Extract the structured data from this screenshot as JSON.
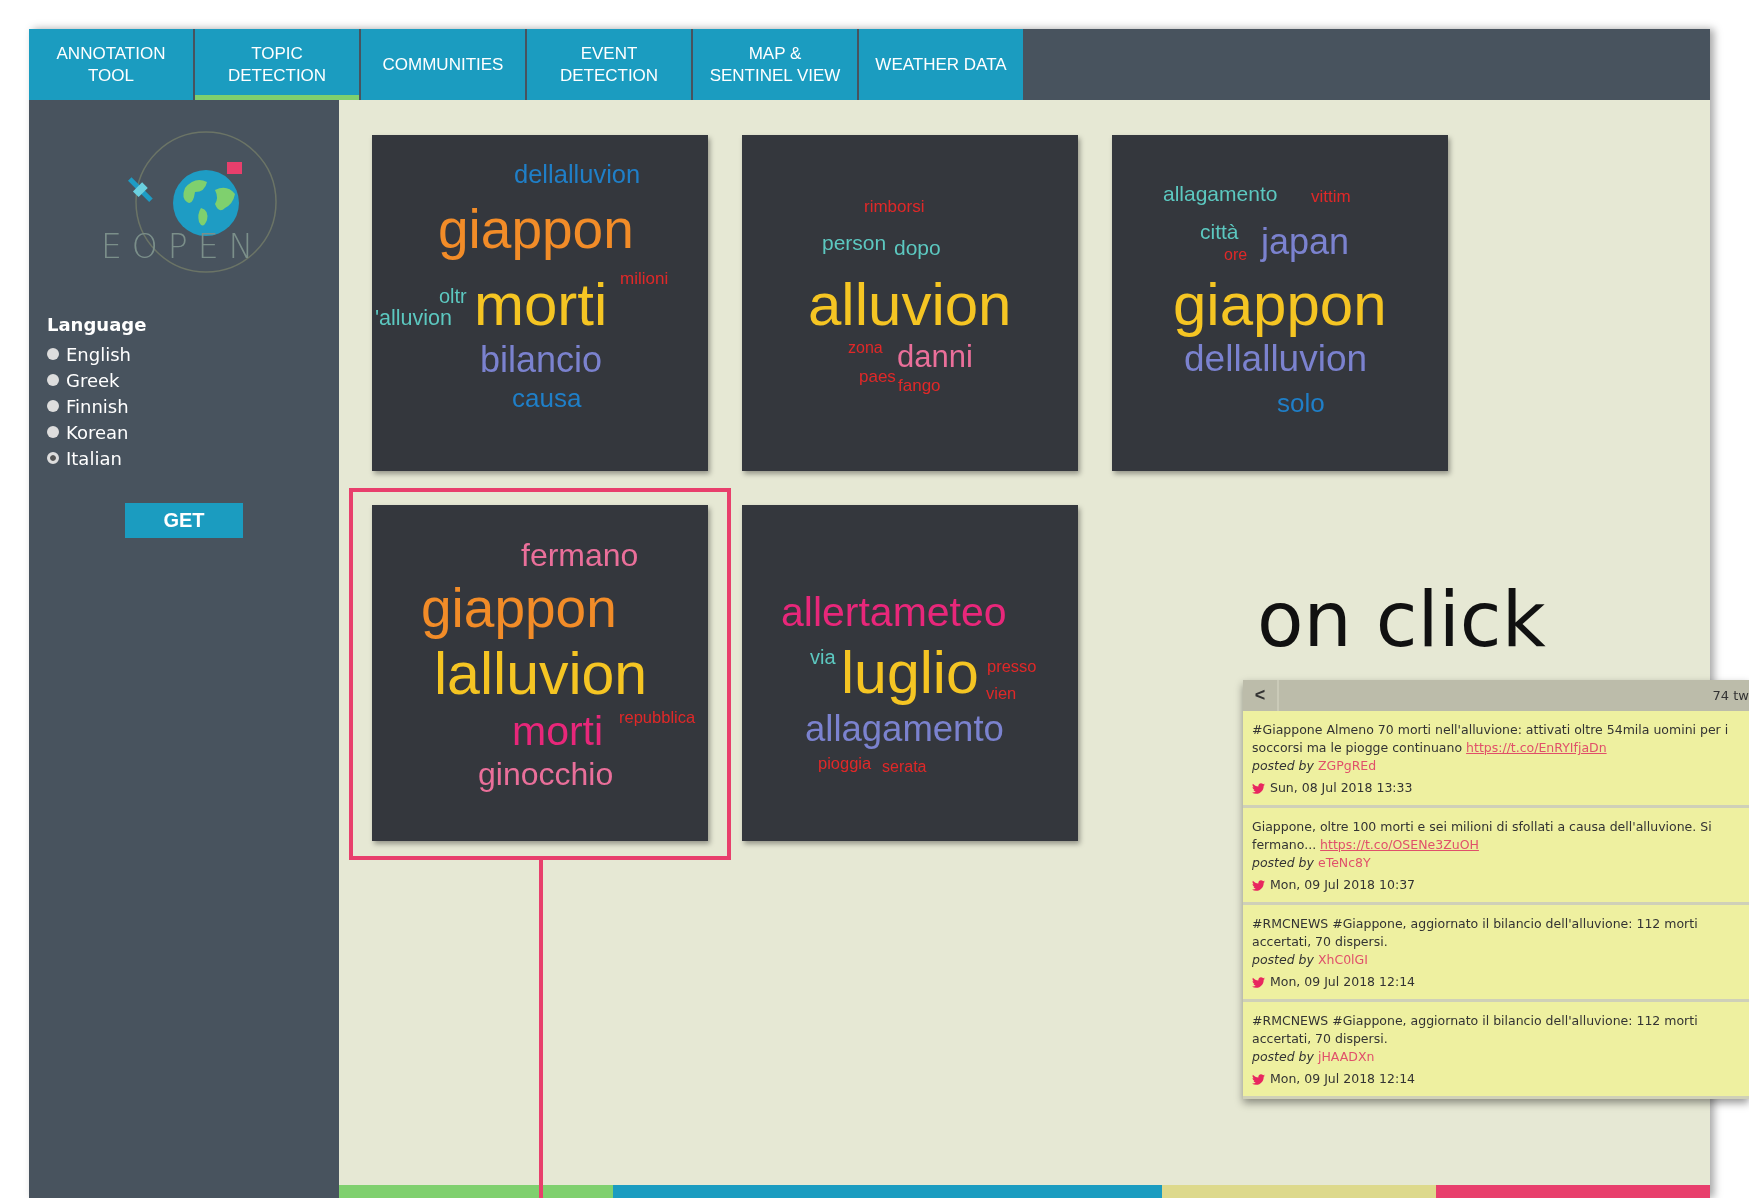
{
  "tabs": [
    {
      "label": "ANNOTATION TOOL",
      "selected": false
    },
    {
      "label": "TOPIC DETECTION",
      "selected": true
    },
    {
      "label": "COMMUNITIES",
      "selected": false
    },
    {
      "label": "EVENT DETECTION",
      "selected": false
    },
    {
      "label": "MAP & SENTINEL VIEW",
      "selected": false
    },
    {
      "label": "WEATHER DATA",
      "selected": false
    }
  ],
  "sidebar": {
    "logo_text": "EOPEN",
    "language_label": "Language",
    "languages": [
      {
        "label": "English",
        "selected": false
      },
      {
        "label": "Greek",
        "selected": false
      },
      {
        "label": "Finnish",
        "selected": false
      },
      {
        "label": "Korean",
        "selected": false
      },
      {
        "label": "Italian",
        "selected": true
      }
    ],
    "button": "GET"
  },
  "clouds": [
    {
      "highlighted": false,
      "words": [
        {
          "text": "dellalluvion",
          "color": "#1f7fc8"
        },
        {
          "text": "giappon",
          "color": "#f28c28"
        },
        {
          "text": "milioni",
          "color": "#e02828"
        },
        {
          "text": "oltr",
          "color": "#5cc8c0"
        },
        {
          "text": "'alluvion",
          "color": "#5cc8c0"
        },
        {
          "text": "morti",
          "color": "#f5c523"
        },
        {
          "text": "bilancio",
          "color": "#7b82cf"
        },
        {
          "text": "causa",
          "color": "#1f7fc8"
        }
      ]
    },
    {
      "highlighted": false,
      "words": [
        {
          "text": "rimborsi",
          "color": "#e02828"
        },
        {
          "text": "person",
          "color": "#5cc8c0"
        },
        {
          "text": "dopo",
          "color": "#5cc8c0"
        },
        {
          "text": "alluvion",
          "color": "#f5c523"
        },
        {
          "text": "zona",
          "color": "#e02828"
        },
        {
          "text": "danni",
          "color": "#ea6f9a"
        },
        {
          "text": "paes",
          "color": "#e02828"
        },
        {
          "text": "fango",
          "color": "#e02828"
        }
      ]
    },
    {
      "highlighted": false,
      "words": [
        {
          "text": "allagamento",
          "color": "#5cc8c0"
        },
        {
          "text": "vittim",
          "color": "#e02828"
        },
        {
          "text": "città",
          "color": "#5cc8c0"
        },
        {
          "text": "ore",
          "color": "#e02828"
        },
        {
          "text": "japan",
          "color": "#7b82cf"
        },
        {
          "text": "giappon",
          "color": "#f5c523"
        },
        {
          "text": "dellalluvion",
          "color": "#7b82cf"
        },
        {
          "text": "solo",
          "color": "#1f7fc8"
        }
      ]
    },
    {
      "highlighted": true,
      "words": [
        {
          "text": "fermano",
          "color": "#ea6f9a"
        },
        {
          "text": "giappon",
          "color": "#f28c28"
        },
        {
          "text": "lalluvion",
          "color": "#f5c523"
        },
        {
          "text": "morti",
          "color": "#e8277a"
        },
        {
          "text": "repubblica",
          "color": "#e02828"
        },
        {
          "text": "ginocchio",
          "color": "#ea6f9a"
        }
      ]
    },
    {
      "highlighted": false,
      "words": [
        {
          "text": "allertameteo",
          "color": "#e8277a"
        },
        {
          "text": "via",
          "color": "#5cc8c0"
        },
        {
          "text": "luglio",
          "color": "#f5c523"
        },
        {
          "text": "presso",
          "color": "#e02828"
        },
        {
          "text": "vien",
          "color": "#e02828"
        },
        {
          "text": "allagamento",
          "color": "#7b82cf"
        },
        {
          "text": "pioggia",
          "color": "#e02828"
        },
        {
          "text": "serata",
          "color": "#e02828"
        }
      ]
    }
  ],
  "annotation": {
    "text": "on click"
  },
  "tweet_panel": {
    "back": "<",
    "count": "74 tw",
    "tweets": [
      {
        "text": "#Giappone Almeno 70 morti nell'alluvione: attivati oltre 54mila uomini per i soccorsi ma le piogge continuano",
        "link": "https://t.co/EnRYIfjaDn",
        "posted_by": "posted by",
        "author": "ZGPgREd",
        "date": "Sun, 08 Jul 2018 13:33"
      },
      {
        "text": "Giappone, oltre 100 morti e sei milioni di sfollati a causa dell'alluvione. Si fermano...",
        "link": "https://t.co/OSENe3ZuOH",
        "posted_by": "posted by",
        "author": "eTeNc8Y",
        "date": "Mon, 09 Jul 2018 10:37"
      },
      {
        "text": "#RMCNEWS #Giappone, aggiornato il bilancio dell'alluvione: 112 morti accertati, 70 dispersi.",
        "posted_by": "posted by",
        "author": "XhC0lGI",
        "date": "Mon, 09 Jul 2018 12:14"
      },
      {
        "text": "#RMCNEWS #Giappone, aggiornato il bilancio dell'alluvione: 112 morti accertati, 70 dispersi.",
        "posted_by": "posted by",
        "author": "jHAADXn",
        "date": "Mon, 09 Jul 2018 12:14"
      }
    ]
  }
}
